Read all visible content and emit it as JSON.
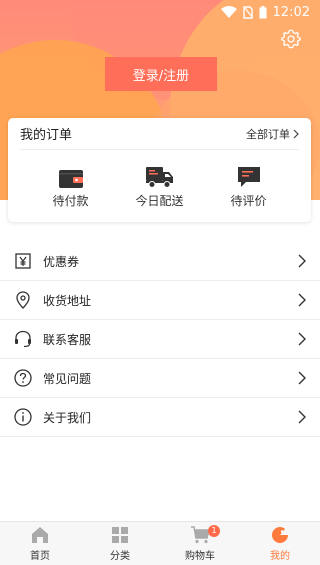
{
  "status_bar": {
    "time": "12:02"
  },
  "header": {
    "login_label": "登录/注册"
  },
  "orders": {
    "title": "我的订单",
    "all_label": "全部订单",
    "items": [
      {
        "label": "待付款",
        "icon": "wallet-icon"
      },
      {
        "label": "今日配送",
        "icon": "delivery-truck-icon"
      },
      {
        "label": "待评价",
        "icon": "comment-icon"
      }
    ]
  },
  "menu": [
    {
      "label": "优惠券",
      "icon": "coupon-icon"
    },
    {
      "label": "收货地址",
      "icon": "location-pin-icon"
    },
    {
      "label": "联系客服",
      "icon": "headset-icon"
    },
    {
      "label": "常见问题",
      "icon": "question-icon"
    },
    {
      "label": "关于我们",
      "icon": "info-icon"
    }
  ],
  "bottom_nav": {
    "items": [
      {
        "label": "首页",
        "icon": "home-icon"
      },
      {
        "label": "分类",
        "icon": "grid-icon"
      },
      {
        "label": "购物车",
        "icon": "cart-icon",
        "badge": "1"
      },
      {
        "label": "我的",
        "icon": "profile-icon",
        "active": true
      }
    ]
  },
  "colors": {
    "accent": "#ff7a3c",
    "login_button": "#ff6e58",
    "badge": "#ff6b4a"
  }
}
